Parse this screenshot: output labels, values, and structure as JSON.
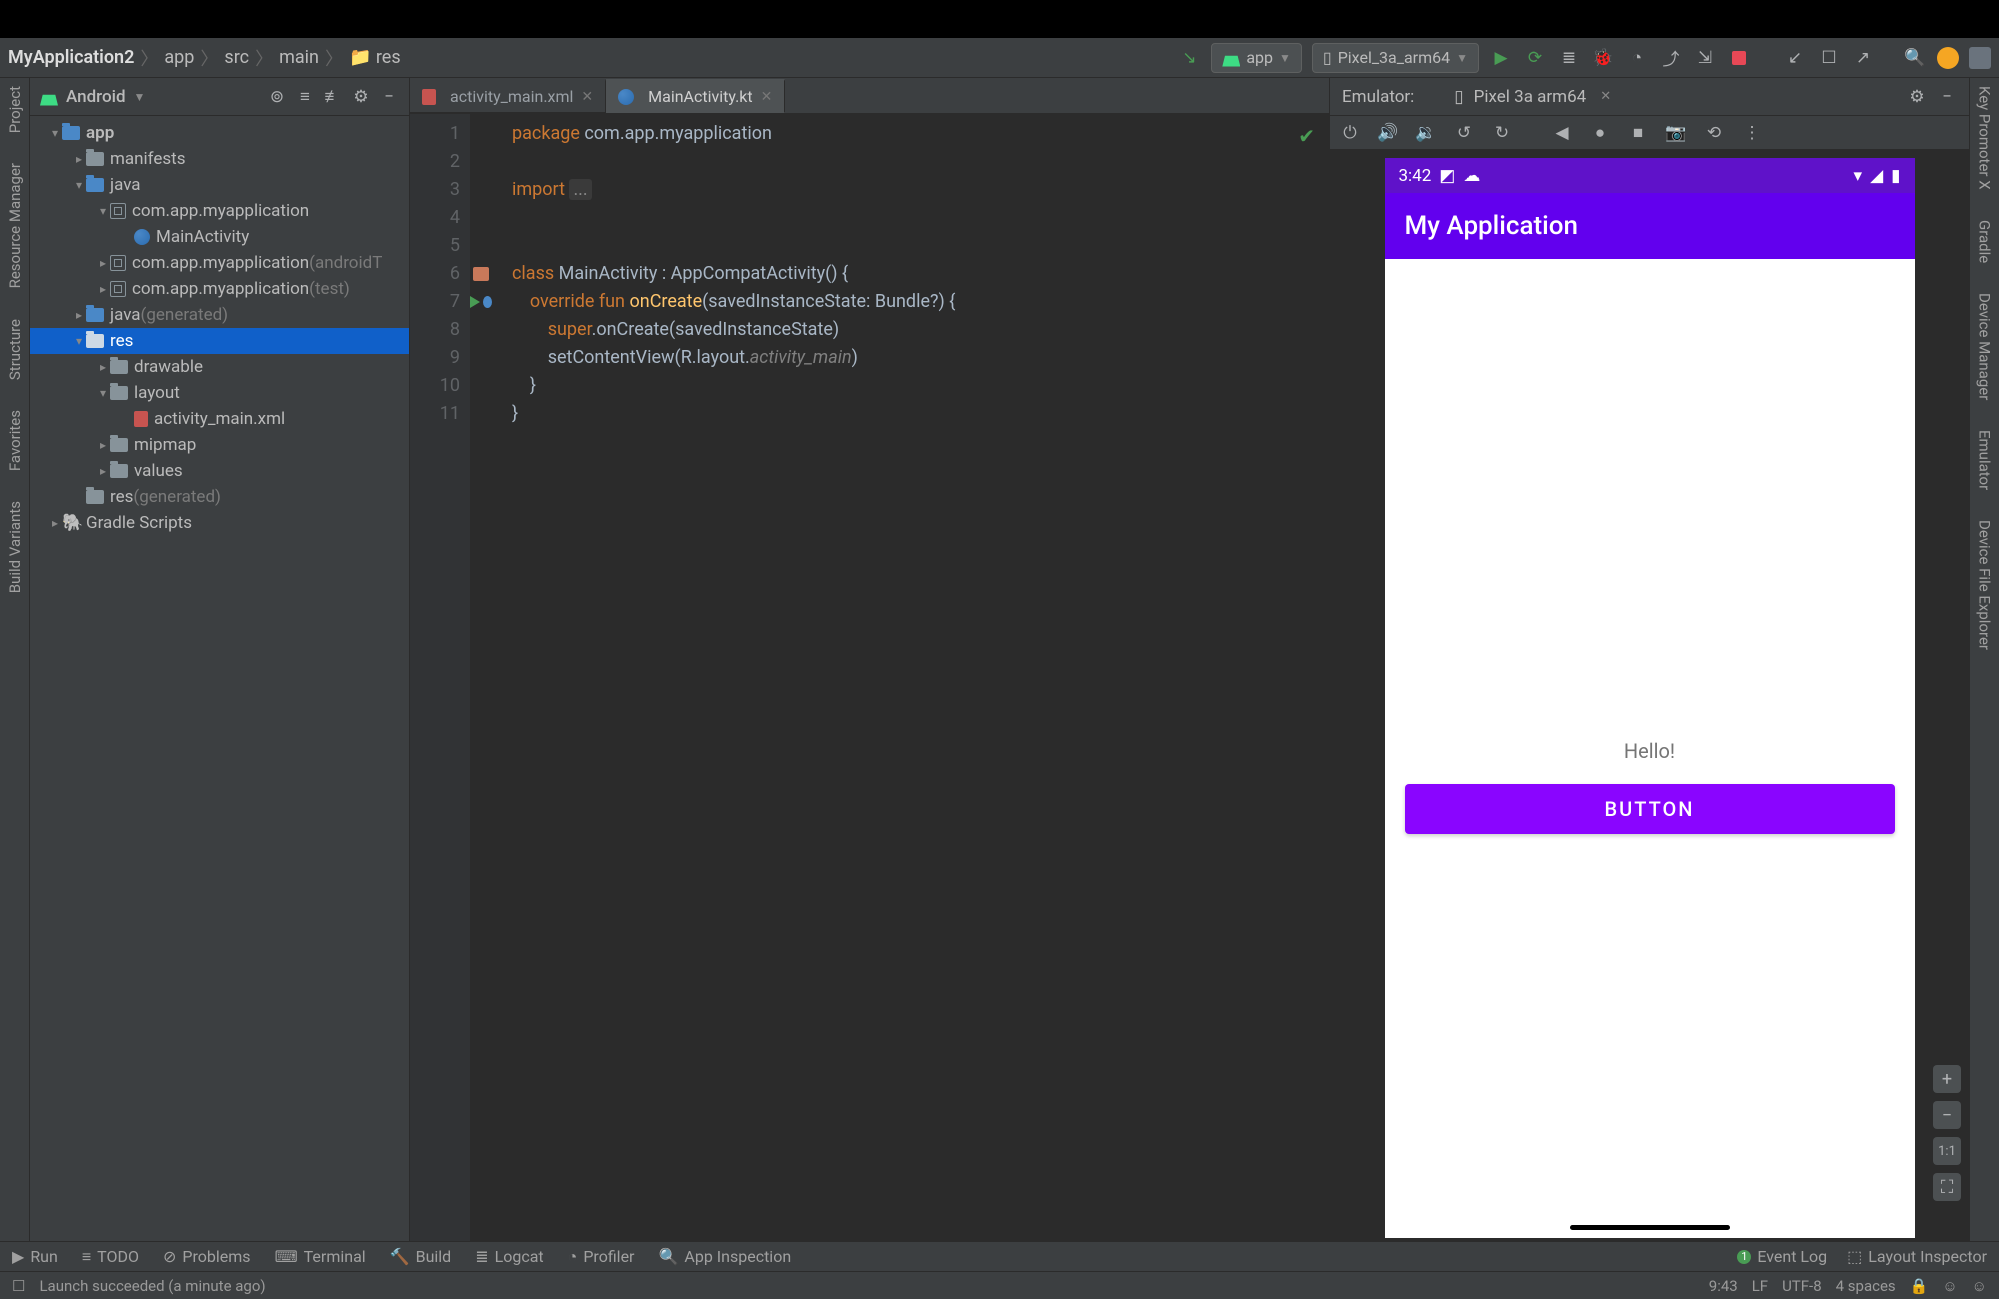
{
  "breadcrumbs": [
    "MyApplication2",
    "app",
    "src",
    "main",
    "res"
  ],
  "run_config": "app",
  "device_selected": "Pixel_3a_arm64",
  "project_view": {
    "title": "Android"
  },
  "tree": [
    {
      "d": 0,
      "tw": "v",
      "ic": "fold-blue",
      "label": "app",
      "bold": true
    },
    {
      "d": 1,
      "tw": ">",
      "ic": "fold",
      "label": "manifests"
    },
    {
      "d": 1,
      "tw": "v",
      "ic": "fold-blue",
      "label": "java"
    },
    {
      "d": 2,
      "tw": "v",
      "ic": "pkg",
      "label": "com.app.myapplication"
    },
    {
      "d": 3,
      "tw": "",
      "ic": "kt",
      "label": "MainActivity"
    },
    {
      "d": 2,
      "tw": ">",
      "ic": "pkg",
      "label": "com.app.myapplication",
      "suffix": "(androidT"
    },
    {
      "d": 2,
      "tw": ">",
      "ic": "pkg",
      "label": "com.app.myapplication",
      "suffix": "(test)"
    },
    {
      "d": 1,
      "tw": ">",
      "ic": "fold-blue",
      "label": "java",
      "suffix": "(generated)"
    },
    {
      "d": 1,
      "tw": "v",
      "ic": "fold-sel",
      "label": "res",
      "sel": true
    },
    {
      "d": 2,
      "tw": ">",
      "ic": "fold",
      "label": "drawable"
    },
    {
      "d": 2,
      "tw": "v",
      "ic": "fold",
      "label": "layout"
    },
    {
      "d": 3,
      "tw": "",
      "ic": "xml",
      "label": "activity_main.xml"
    },
    {
      "d": 2,
      "tw": ">",
      "ic": "fold",
      "label": "mipmap"
    },
    {
      "d": 2,
      "tw": ">",
      "ic": "fold",
      "label": "values"
    },
    {
      "d": 1,
      "tw": "",
      "ic": "fold",
      "label": "res",
      "suffix": "(generated)"
    },
    {
      "d": 0,
      "tw": ">",
      "ic": "grad",
      "label": "Gradle Scripts"
    }
  ],
  "editor_tabs": [
    {
      "icon": "xml",
      "label": "activity_main.xml",
      "active": false
    },
    {
      "icon": "kt",
      "label": "MainActivity.kt",
      "active": true
    }
  ],
  "code_lines": [
    {
      "n": 1,
      "html": "<span class='kw'>package</span> <span class='pkg'>com.app.myapplication</span>"
    },
    {
      "n": 2,
      "html": ""
    },
    {
      "n": 3,
      "html": "<span class='kw'>import</span> <span class='dim2'>...</span>"
    },
    {
      "n": 4,
      "html": ""
    },
    {
      "n": 5,
      "html": ""
    },
    {
      "n": 6,
      "html": "<span class='kw'>class</span> MainActivity : AppCompatActivity() {",
      "gblk": true
    },
    {
      "n": 7,
      "html": "    <span class='kw'>override fun</span> <span class='fn'>onCreate</span>(savedInstanceState: Bundle?) {",
      "gplay": true,
      "gov": true
    },
    {
      "n": 8,
      "html": "        <span class='kw'>super</span>.onCreate(savedInstanceState)"
    },
    {
      "n": 9,
      "html": "        setContentView(R.layout.<span class='it'>activity_main</span>)"
    },
    {
      "n": 10,
      "html": "    }"
    },
    {
      "n": 11,
      "html": "}"
    }
  ],
  "emulator": {
    "header": "Emulator:",
    "device_tab": "Pixel 3a arm64",
    "status_time": "3:42",
    "app_title": "My Application",
    "hello": "Hello!",
    "button": "BUTTON",
    "zoom_ratio": "1:1"
  },
  "bottom_tabs": [
    "Run",
    "TODO",
    "Problems",
    "Terminal",
    "Build",
    "Logcat",
    "Profiler",
    "App Inspection"
  ],
  "bottom_right": [
    "Event Log",
    "Layout Inspector"
  ],
  "status": {
    "msg": "Launch succeeded (a minute ago)",
    "time": "9:43",
    "le": "LF",
    "enc": "UTF-8",
    "indent": "4 spaces"
  },
  "left_rail": [
    "Project",
    "Resource Manager",
    "Structure",
    "Favorites",
    "Build Variants"
  ],
  "right_rail": [
    "Key Promoter X",
    "Gradle",
    "Device Manager",
    "Emulator",
    "Device File Explorer"
  ]
}
